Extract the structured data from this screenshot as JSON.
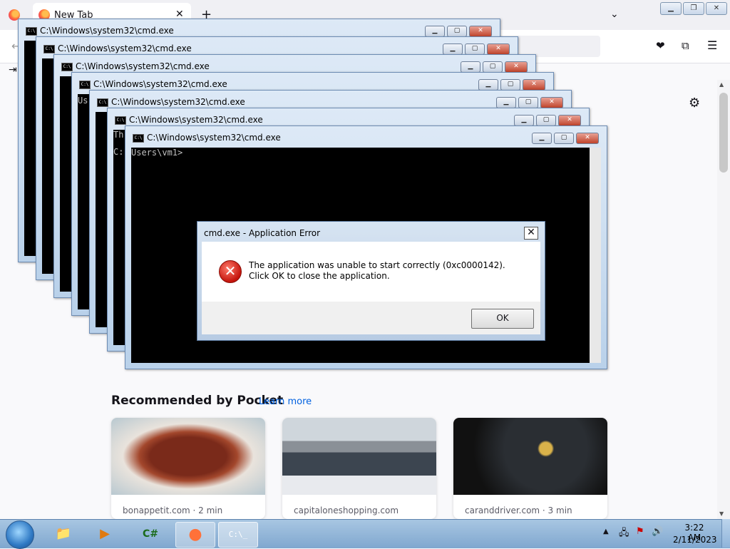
{
  "browser": {
    "tab_title": "New Tab",
    "tab_close": "✕",
    "new_tab": "+",
    "tab_list": "⌄",
    "window_buttons": {
      "min": "▁",
      "max": "❐",
      "close": "✕"
    },
    "icons": {
      "back": "←",
      "pocket": "❤",
      "extensions": "⧉",
      "menu": "☰",
      "signin": "⇥",
      "settings": "⚙"
    }
  },
  "cmd_windows": [
    {
      "title": "C:\\Windows\\system32\\cmd.exe"
    },
    {
      "title": "C:\\Windows\\system32\\cmd.exe"
    },
    {
      "title": "C:\\Windows\\system32\\cmd.exe"
    },
    {
      "title": "C:\\Windows\\system32\\cmd.exe"
    },
    {
      "title": "C:\\Windows\\system32\\cmd.exe"
    },
    {
      "title": "C:\\Windows\\system32\\cmd.exe"
    },
    {
      "title": "C:\\Windows\\system32\\cmd.exe"
    }
  ],
  "cmd_buttons": {
    "min": "▁",
    "max": "▢",
    "close": "✕"
  },
  "terminal": {
    "fragment_us": "Us",
    "fragment_th": "Th",
    "fragment_c": "C:",
    "prompt": "Users\\vm1>"
  },
  "error_dialog": {
    "title": "cmd.exe - Application Error",
    "close": "✕",
    "icon": "✕",
    "message": "The application was unable to start correctly (0xc0000142). Click OK to close the application.",
    "ok_label": "OK"
  },
  "pocket": {
    "heading": "Recommended by Pocket",
    "learn_more": "Learn more",
    "cards": [
      {
        "source": "bonappetit.com · 2 min"
      },
      {
        "source": "capitaloneshopping.com"
      },
      {
        "source": "caranddriver.com · 3 min"
      }
    ]
  },
  "taskbar": {
    "items": {
      "explorer": "📁",
      "media": "▶",
      "csharp": "C#",
      "firefox": "●",
      "cmd": "C:\\_"
    },
    "tray": {
      "arrow": "▲",
      "network": "🖧",
      "flag": "⚑",
      "volume": "🔊"
    },
    "time": "3:22 AM",
    "date": "2/11/2023"
  }
}
